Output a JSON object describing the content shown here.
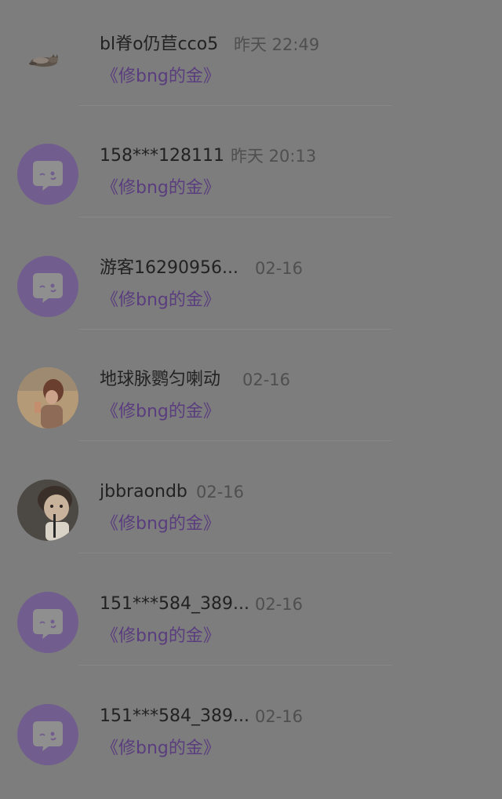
{
  "comments": [
    {
      "name": "bl脊o仍苣cco5",
      "time": "昨天 22:49",
      "work": "《修bng的金》",
      "avatar": "cat-photo"
    },
    {
      "name": "158***128111",
      "time": "昨天 20:13",
      "work": "《修bng的金》",
      "avatar": "default-chat-bubble"
    },
    {
      "name": "游客16290956...",
      "time": "02-16",
      "work": "《修bng的金》",
      "avatar": "default-chat-bubble"
    },
    {
      "name": "地球脉鹦匀喇动",
      "time": "02-16",
      "work": "《修bng的金》",
      "avatar": "girl-photo"
    },
    {
      "name": "jbbraondb",
      "time": "02-16",
      "work": "《修bng的金》",
      "avatar": "child-photo"
    },
    {
      "name": "151***584_389...",
      "time": "02-16",
      "work": "《修bng的金》",
      "avatar": "default-chat-bubble"
    },
    {
      "name": "151***584_389...",
      "time": "02-16",
      "work": "《修bng的金》",
      "avatar": "default-chat-bubble"
    }
  ],
  "colors": {
    "overlay_background": "#7d7d7d",
    "default_avatar": "#725e8e",
    "work_title": "#5a3d7e"
  }
}
